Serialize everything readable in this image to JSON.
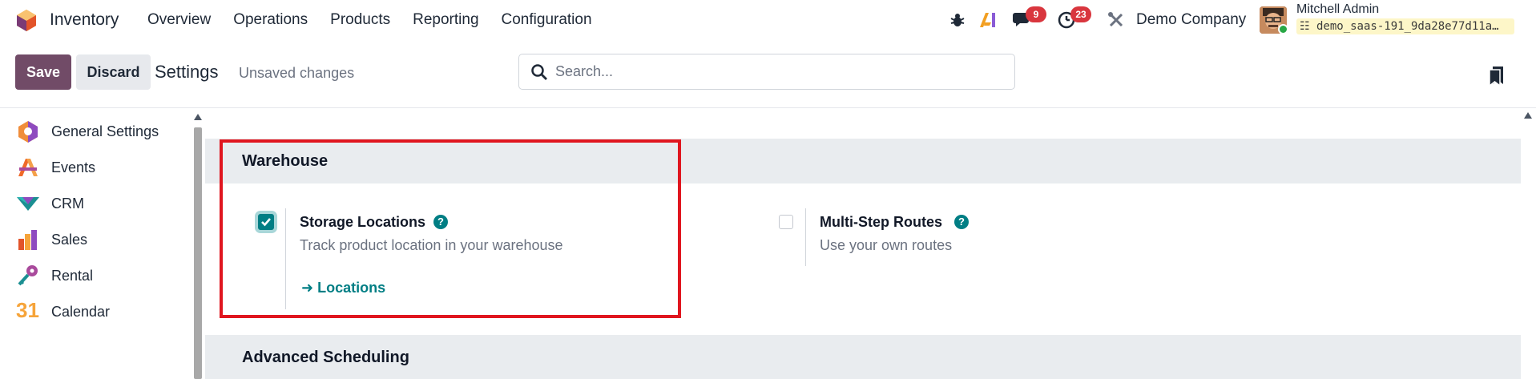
{
  "navbar": {
    "app_name": "Inventory",
    "menu": [
      "Overview",
      "Operations",
      "Products",
      "Reporting",
      "Configuration"
    ],
    "messages_count": "9",
    "activities_count": "23",
    "company": "Demo Company",
    "user_name": "Mitchell Admin",
    "database": "demo_saas-191_9da28e77d11a…"
  },
  "control": {
    "save_label": "Save",
    "discard_label": "Discard",
    "title": "Settings",
    "status": "Unsaved changes",
    "search_placeholder": "Search..."
  },
  "sidebar": {
    "items": [
      {
        "label": "General Settings",
        "icon": "general-settings-icon"
      },
      {
        "label": "Events",
        "icon": "events-icon"
      },
      {
        "label": "CRM",
        "icon": "crm-icon"
      },
      {
        "label": "Sales",
        "icon": "sales-icon"
      },
      {
        "label": "Rental",
        "icon": "rental-icon"
      },
      {
        "label": "Calendar",
        "icon": "calendar-icon"
      }
    ],
    "calendar_icon_text": "31"
  },
  "main": {
    "warehouse": {
      "title": "Warehouse",
      "storage": {
        "title": "Storage Locations",
        "description": "Track product location in your warehouse",
        "checked": true,
        "link": "Locations"
      },
      "routes": {
        "title": "Multi-Step Routes",
        "description": "Use your own routes",
        "checked": false
      }
    },
    "advanced": {
      "title": "Advanced Scheduling"
    },
    "help_glyph": "?"
  },
  "colors": {
    "brand": "#714b67",
    "accent": "#017e84",
    "badge": "#d9363e",
    "highlight": "#e0161f"
  }
}
